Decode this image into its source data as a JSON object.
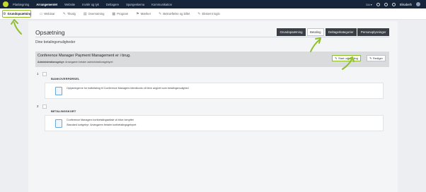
{
  "topnav": {
    "items": [
      "Planlægning",
      "Arrangementet",
      "Website",
      "Invitér og tyk",
      "Deltagere",
      "Spørgeskema",
      "Kommunikation"
    ],
    "active_index": 1,
    "language": "DA ▾",
    "user": "Elisabeth"
  },
  "subnav": {
    "items": [
      {
        "icon": "⚙",
        "label": "Grundopsætning"
      },
      {
        "icon": "▭",
        "label": "Webinar"
      },
      {
        "icon": "✎",
        "label": "Tilvalg"
      },
      {
        "icon": "▤",
        "label": "Overnatning"
      },
      {
        "icon": "▦",
        "label": "Program"
      },
      {
        "icon": "⚑",
        "label": "Mærker"
      },
      {
        "icon": "✎",
        "label": "Bekræftelse og billet"
      },
      {
        "icon": "✎",
        "label": "Eksternt login"
      }
    ],
    "active_index": 0
  },
  "page": {
    "title": "Opsætning",
    "tabs": [
      "Grundopsætning",
      "Betaling",
      "Deltagerkategorier",
      "Personoplysninger"
    ],
    "active_tab": 1,
    "section_title": "Dine betalingsmuligheder"
  },
  "status": {
    "main": "Conference Manager Payment Management er i brug.",
    "sub_label": "Administrationsgebyr:",
    "sub_value": "Arrangøren betaler administrationsgebyret",
    "start_button": "Start udbetaling",
    "edit_button": "Redigér"
  },
  "options": [
    {
      "number": "1",
      "title": "BANKOVERFØRSEL",
      "line1": "Oplysningerne for indbetaling til Conference Managers klientkonto vil blive angivet som betalingsmulighed",
      "line2": ""
    },
    {
      "number": "2",
      "title": "BETALINGSKORT",
      "line1": "Conference Managers kortbetalingsaftale vil blive benyttet",
      "line2": "Standard kortgebyr: Arrangøren betaler kortbetalingsgebyret"
    }
  ],
  "colors": {
    "topbar": "#16253a",
    "accent_green": "#8fbf2a",
    "tab_dark": "#3a3f46"
  }
}
